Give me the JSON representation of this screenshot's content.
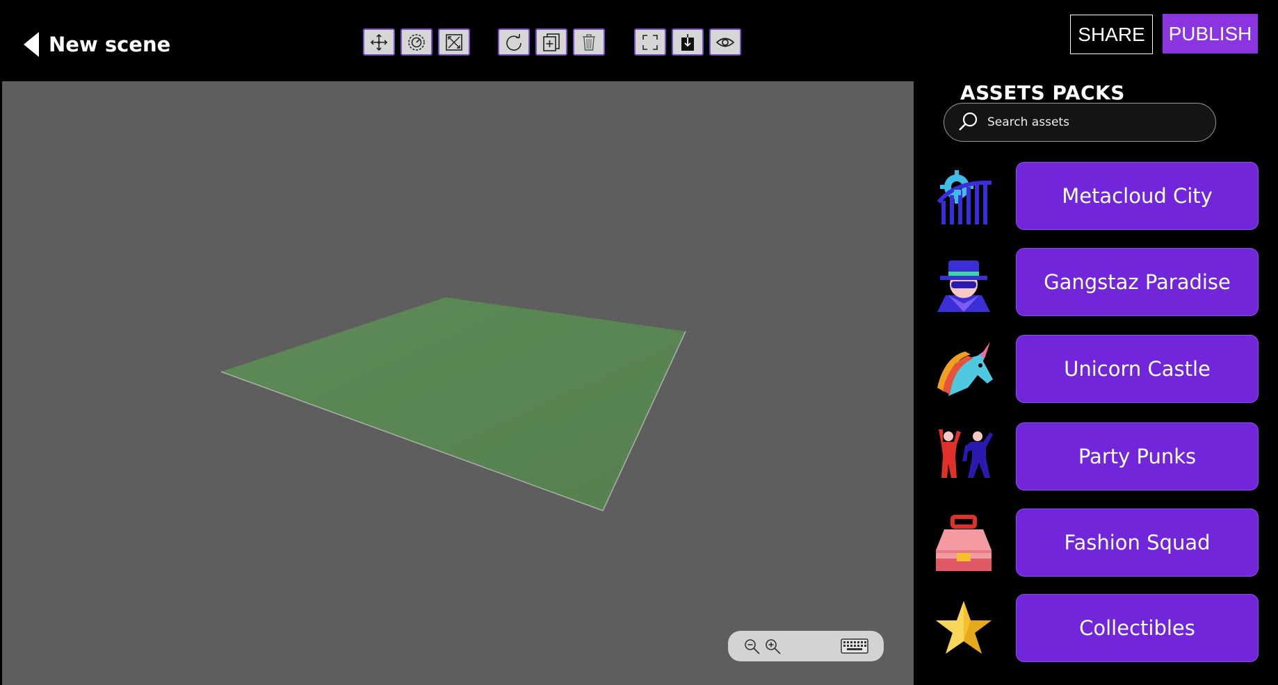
{
  "header": {
    "back_icon": "back-arrow-icon",
    "title": "New scene",
    "share_label": "SHARE",
    "publish_label": "PUBLISH",
    "tools": [
      {
        "name": "move-tool",
        "icon": "move-arrows-icon"
      },
      {
        "name": "rotate-tool",
        "icon": "rotate-gizmo-icon"
      },
      {
        "name": "scale-tool",
        "icon": "scale-icon"
      },
      {
        "name": "reset-tool",
        "icon": "refresh-icon"
      },
      {
        "name": "duplicate-tool",
        "icon": "duplicate-icon"
      },
      {
        "name": "delete-tool",
        "icon": "trash-icon"
      },
      {
        "name": "fullscreen-tool",
        "icon": "fullscreen-icon"
      },
      {
        "name": "download-tool",
        "icon": "download-icon"
      },
      {
        "name": "preview-tool",
        "icon": "eye-icon"
      }
    ]
  },
  "viewport": {
    "background": "#5e5e5e",
    "ground_color": "#5b8556",
    "zoom_out_icon": "zoom-out-icon",
    "zoom_in_icon": "zoom-in-icon",
    "keyboard_icon": "keyboard-icon"
  },
  "panel": {
    "title": "ASSETS PACKS",
    "search_placeholder": "Search assets",
    "packs": [
      {
        "label": "Metacloud City",
        "icon": "roller-coaster-icon"
      },
      {
        "label": "Gangstaz Paradise",
        "icon": "gangster-icon"
      },
      {
        "label": "Unicorn Castle",
        "icon": "unicorn-icon"
      },
      {
        "label": "Party Punks",
        "icon": "dancers-icon"
      },
      {
        "label": "Fashion Squad",
        "icon": "handbag-icon"
      },
      {
        "label": "Collectibles",
        "icon": "star-icon"
      }
    ]
  },
  "colors": {
    "accent": "#7127d9",
    "publish": "#8a35e0",
    "tool_border": "#7b4fc4"
  }
}
